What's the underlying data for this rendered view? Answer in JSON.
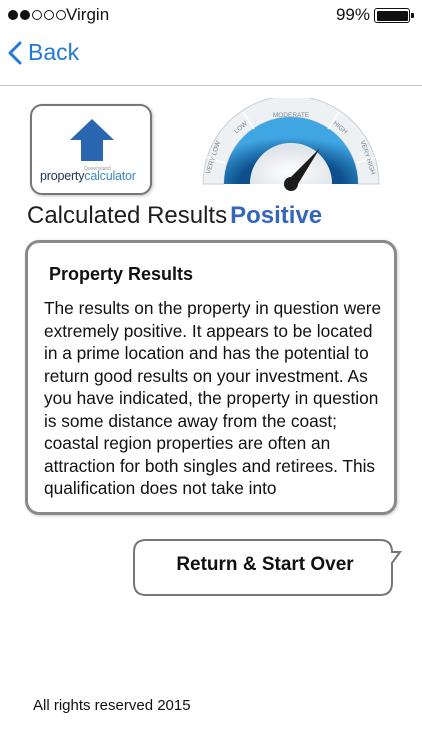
{
  "status_bar": {
    "carrier": "Virgin",
    "battery_percent": "99%",
    "signal_filled": 2,
    "signal_total": 5
  },
  "nav": {
    "back_label": "Back",
    "accent_color": "#2279d8"
  },
  "logo": {
    "small_text": "Queensland",
    "brand_part1": "property",
    "brand_part2": "calculator"
  },
  "gauge": {
    "labels": [
      "VERY LOW",
      "LOW",
      "MODERATE",
      "HIGH",
      "VERY HIGH"
    ],
    "level": "HIGH"
  },
  "results": {
    "label": "Calculated Results",
    "value": "Positive",
    "value_color": "#3467ba"
  },
  "card": {
    "title": "Property Results",
    "body": "The results on the property in question were extremely positive. It appears to be located in a prime location and has the potential to return good results on your investment. As you have indicated, the property in question is some distance away from the coast; coastal region properties are often an attraction for both singles and retirees. This qualification does not take into"
  },
  "actions": {
    "return_label": "Return & Start Over"
  },
  "footer": {
    "text": "All rights reserved 2015"
  }
}
